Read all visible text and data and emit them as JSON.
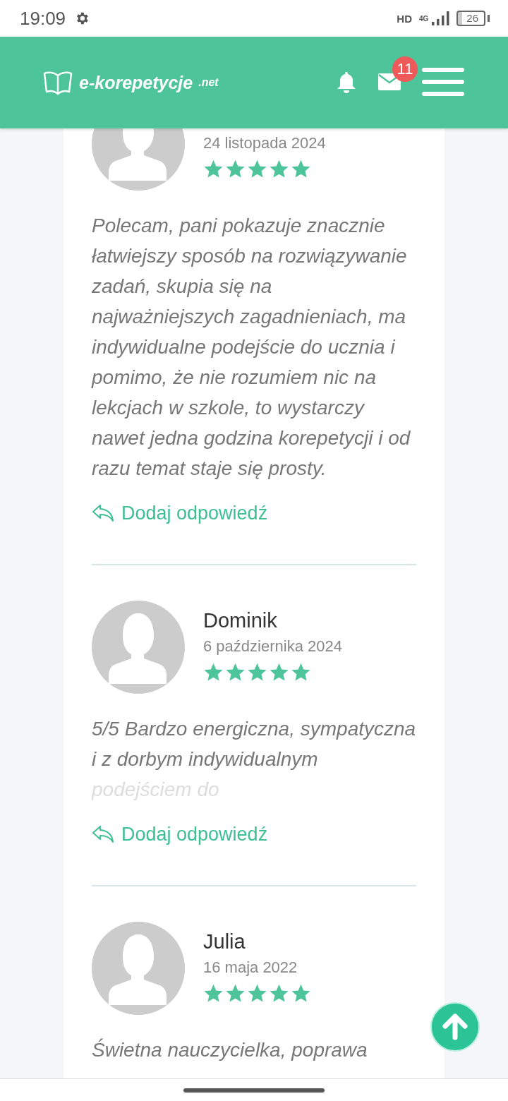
{
  "status_bar": {
    "time": "19:09",
    "hd": "HD",
    "network": "4G",
    "battery": "26"
  },
  "header": {
    "logo_main": "e-korepetycje",
    "logo_suffix": ".net",
    "mail_badge": "11"
  },
  "reviews": [
    {
      "date": "24 listopada 2024",
      "stars": 5,
      "text": "Polecam, pani pokazuje znacznie łatwiejszy sposób na rozwiązywanie zadań, skupia się na najważniejszych zagadnieniach, ma indywidualne podejście do ucznia i pomimo, że nie rozumiem nic na lekcjach w szkole, to wystarczy nawet jedna godzina korepetycji i od razu temat staje się prosty.",
      "faded": false,
      "reply": "Dodaj odpowiedź"
    },
    {
      "name": "Dominik",
      "date": "6 października 2024",
      "stars": 5,
      "text": "5/5 Bardzo energiczna, sympatyczna i z dorbym indywidualnym podejściem do",
      "faded": true,
      "reply": "Dodaj odpowiedź"
    },
    {
      "name": "Julia",
      "date": "16 maja 2022",
      "stars": 5,
      "text": "Świetna nauczycielka, poprawa",
      "faded": false
    }
  ]
}
